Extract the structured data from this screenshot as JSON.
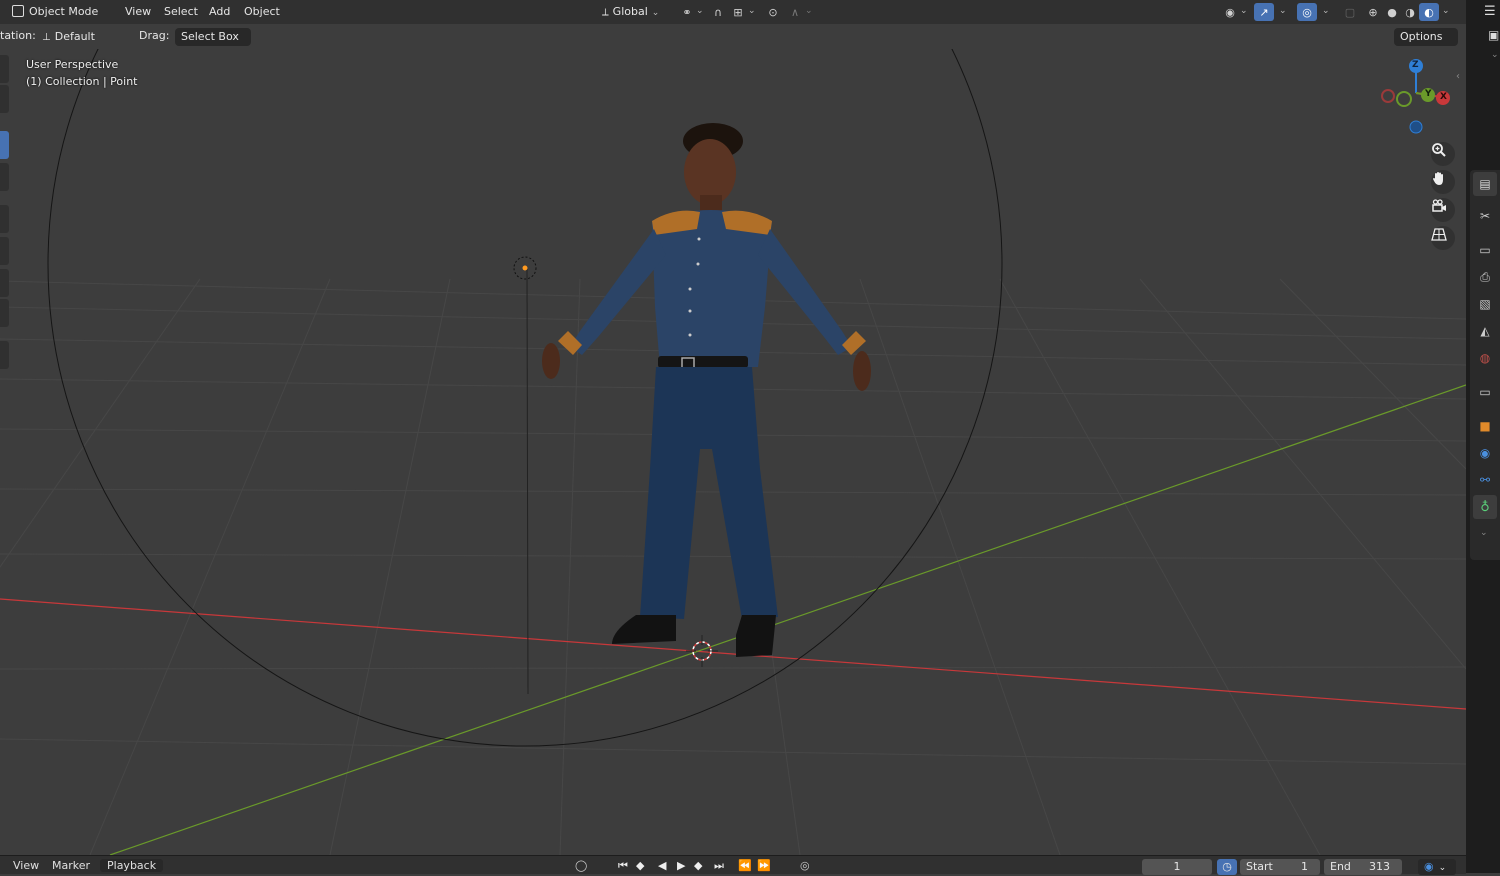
{
  "header": {
    "mode": "Object Mode",
    "menus": [
      "View",
      "Select",
      "Add",
      "Object"
    ],
    "orientation": "Global",
    "options_label": "Options"
  },
  "toolrow": {
    "orientation_label": "tation:",
    "orientation_value": "Default",
    "drag_label": "Drag:",
    "drag_value": "Select Box"
  },
  "viewport": {
    "view_name": "User Perspective",
    "collection": "(1) Collection | Point",
    "gizmo_axes": [
      "Z",
      "Y",
      "X"
    ]
  },
  "timeline": {
    "menus": [
      "View",
      "Marker",
      "Playback"
    ],
    "current_frame": "1",
    "start_label": "Start",
    "start_value": "1",
    "end_label": "End",
    "end_value": "313"
  },
  "colors": {
    "x_axis": "#c8383a",
    "y_axis": "#6a9a2a",
    "z_axis": "#2f7fd6",
    "active": "#4772b3"
  }
}
